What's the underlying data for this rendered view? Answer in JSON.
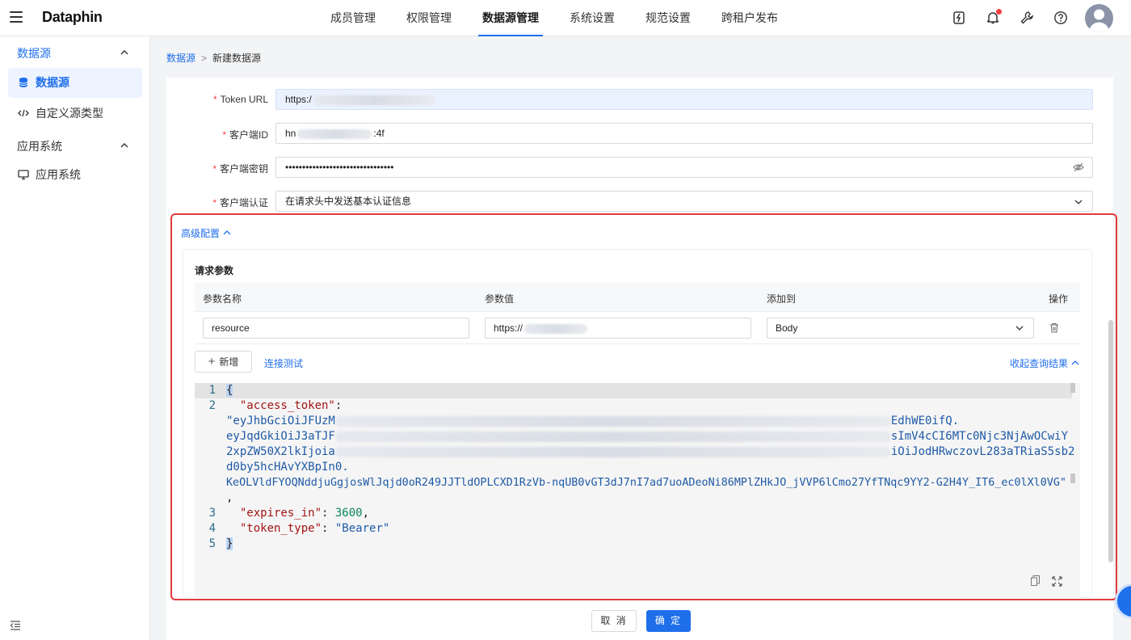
{
  "header": {
    "logo": "Dataphin",
    "nav": [
      "成员管理",
      "权限管理",
      "数据源管理",
      "系统设置",
      "规范设置",
      "跨租户发布"
    ],
    "active_nav": "数据源管理"
  },
  "sidebar": {
    "group1": "数据源",
    "item1": "数据源",
    "item2": "自定义源类型",
    "group2": "应用系统",
    "item3": "应用系统"
  },
  "breadcrumb": {
    "root": "数据源",
    "sep": ">",
    "current": "新建数据源"
  },
  "form": {
    "token_url_label": "Token URL",
    "token_url_value": "https:/",
    "client_id_label": "客户端ID",
    "client_id_prefix": "hn",
    "client_id_suffix": ":4f",
    "client_secret_label": "客户端密钥",
    "client_secret_value": "••••••••••••••••••••••••••••••••",
    "client_auth_label": "客户端认证",
    "client_auth_value": "在请求头中发送基本认证信息"
  },
  "advanced": {
    "toggle_label": "高级配置",
    "section_title": "请求参数",
    "columns": [
      "参数名称",
      "参数值",
      "添加到",
      "操作"
    ],
    "row": {
      "name": "resource",
      "value": "https://",
      "add_to": "Body"
    },
    "add_button": "新增",
    "test_link": "连接测试",
    "collapse_result": "收起查询结果"
  },
  "code": {
    "line_numbers": [
      "1",
      "2",
      "3",
      "4",
      "5"
    ],
    "l1": "{",
    "l2_key": "\"access_token\"",
    "l2_colon": ":",
    "t1a": "\"eyJhbGciOiJFUzM",
    "t1b": "EdhWE0ifQ.",
    "t2a": "eyJqdGkiOiJ3aTJF",
    "t2b": "sImV4cCI6MTc0Njc3NjAwOCwiY",
    "t3a": "2xpZW50X2lkIjoia",
    "t3b": "iOiJodHRwczovL283aTRiaS5sb2",
    "t4": "d0by5hcHAvYXBpIn0.",
    "t5": "KeOLVldFYOQNddjuGgjosWlJqjd0oR249JJTldOPLCXD1RzVb-nqUB0vGT3dJ7nI7ad7uoADeoNi86MPlZHkJO_jVVP6lCmo27YfTNqc9YY2-G2H4Y_IT6_ec0lXl0VG\"",
    "t6": ",",
    "l3_key": "\"expires_in\"",
    "l3_val": "3600",
    "l4_key": "\"token_type\"",
    "l4_val": "\"Bearer\"",
    "l5": "}"
  },
  "footer": {
    "cancel": "取 消",
    "ok": "确 定"
  }
}
